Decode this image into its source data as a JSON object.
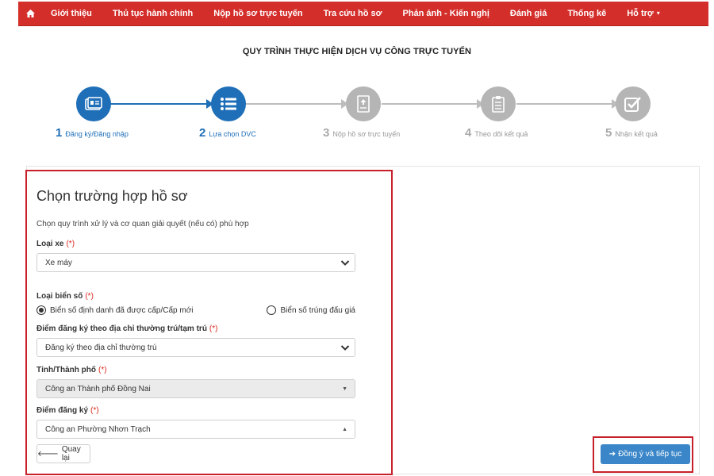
{
  "nav": {
    "home_icon": "home-icon",
    "items": [
      "Giới thiệu",
      "Thủ tục hành chính",
      "Nộp hồ sơ trực tuyến",
      "Tra cứu hồ sơ",
      "Phản ánh - Kiến nghị",
      "Đánh giá",
      "Thống kê",
      "Hỗ trợ"
    ],
    "dropdown_caret": "▾"
  },
  "page_title": "QUY TRÌNH THỰC HIỆN DỊCH VỤ CÔNG TRỰC TUYẾN",
  "steps": [
    {
      "num": "1",
      "label": "Đăng ký/Đăng nhập",
      "icon": "id-card-icon",
      "state": "done"
    },
    {
      "num": "2",
      "label": "Lựa chọn DVC",
      "icon": "list-icon",
      "state": "current"
    },
    {
      "num": "3",
      "label": "Nộp hồ sơ trực tuyến",
      "icon": "document-upload-icon",
      "state": "pending"
    },
    {
      "num": "4",
      "label": "Theo dõi kết quả",
      "icon": "clipboard-icon",
      "state": "pending"
    },
    {
      "num": "5",
      "label": "Nhận kết quả",
      "icon": "check-square-icon",
      "state": "pending"
    }
  ],
  "form": {
    "title": "Chọn trường hợp hồ sơ",
    "subtitle": "Chọn quy trình xử lý và cơ quan giải quyết (nếu có) phù hợp",
    "required_mark": "(*)",
    "vehicle_type": {
      "label": "Loại xe",
      "value": "Xe máy"
    },
    "plate_type": {
      "label": "Loại biển số",
      "options": [
        "Biển số định danh đã được cấp/Cấp mới",
        "Biển số trúng đấu giá"
      ],
      "selected": 0
    },
    "registration_address": {
      "label": "Điểm đăng ký theo địa chỉ thường trú/tạm trú",
      "value": "Đăng ký theo địa chỉ thường trú"
    },
    "province": {
      "label": "Tỉnh/Thành phố",
      "value": "Công an Thành phố Đồng Nai"
    },
    "registration_point": {
      "label": "Điểm đăng ký",
      "value": "Công an Phường Nhơn Trạch"
    }
  },
  "buttons": {
    "back": "Quay lại",
    "next": "Đồng ý và tiếp tục"
  },
  "colors": {
    "nav_red": "#d42e2a",
    "step_active": "#1f6fb8",
    "step_inactive": "#b5b5b5",
    "highlight_border": "#c7202a",
    "primary_button": "#3a86c8",
    "required": "#d9261c"
  }
}
